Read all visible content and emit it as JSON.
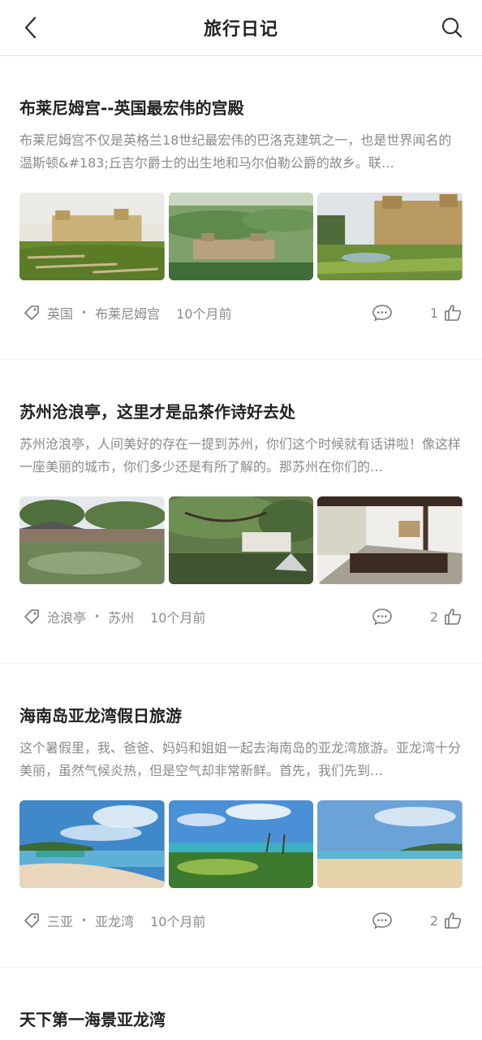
{
  "header": {
    "title": "旅行日记"
  },
  "posts": [
    {
      "title": "布莱尼姆宫--英国最宏伟的宫殿",
      "excerpt": "布莱尼姆宫不仅是英格兰18世纪最宏伟的巴洛克建筑之一，也是世界闻名的温斯顿&#183;丘吉尔爵士的出生地和马尔伯勒公爵的故乡。联…",
      "tag_country": "英国",
      "tag_place": "布莱尼姆宫",
      "time": "10个月前",
      "likes": "1"
    },
    {
      "title": "苏州沧浪亭，这里才是品茶作诗好去处",
      "excerpt": "苏州沧浪亭，人间美好的存在一提到苏州，你们这个时候就有话讲啦！像这样一座美丽的城市，你们多少还是有所了解的。那苏州在你们的…",
      "tag_country": "沧浪亭",
      "tag_place": "苏州",
      "time": "10个月前",
      "likes": "2"
    },
    {
      "title": "海南岛亚龙湾假日旅游",
      "excerpt": "这个暑假里，我、爸爸、妈妈和姐姐一起去海南岛的亚龙湾旅游。亚龙湾十分美丽，虽然气候炎热，但是空气却非常新鲜。首先，我们先到…",
      "tag_country": "三亚",
      "tag_place": "亚龙湾",
      "time": "10个月前",
      "likes": "2"
    },
    {
      "title": "天下第一海景亚龙湾"
    }
  ],
  "separator": "•",
  "icons": {
    "back": "chevron-left-icon",
    "search": "search-icon",
    "tag": "tag-icon",
    "comment": "comment-icon",
    "like": "thumbs-up-icon"
  }
}
